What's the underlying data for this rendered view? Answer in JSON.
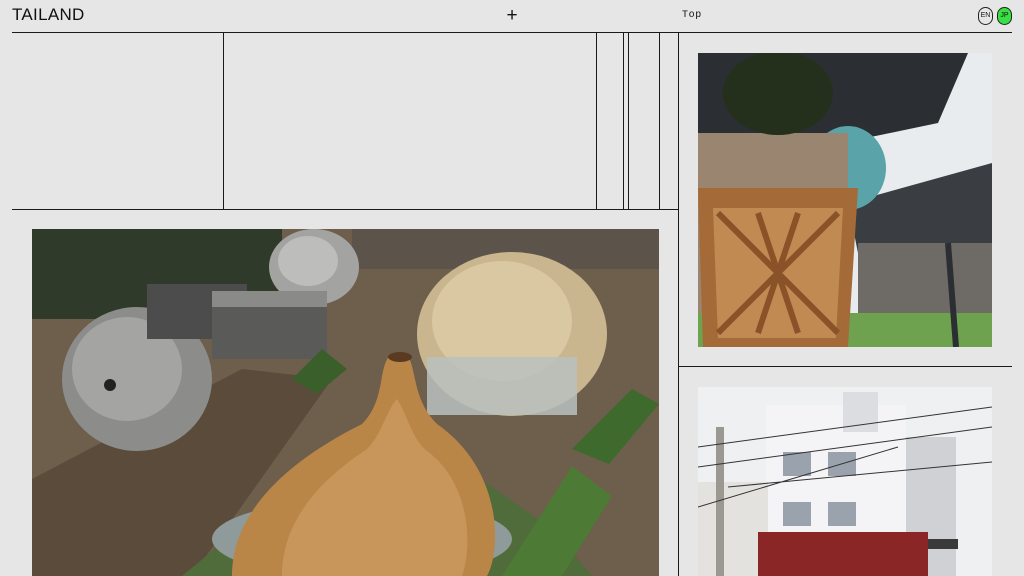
{
  "header": {
    "logo": "TAILAND",
    "menu_icon": "plus-icon",
    "nav_top": "Top",
    "lang_en": "EN",
    "lang_jp": "JP"
  },
  "colors": {
    "background": "#e6e6e6",
    "line": "#1a1a1a",
    "active_lang": "#3ae043"
  },
  "images": {
    "main": "aerial-glamping-domes-and-wooden-shell-structure",
    "top_right": "wooden-lattice-tower-under-canopy-roof",
    "bottom_right": "white-apartment-building-with-power-lines"
  }
}
